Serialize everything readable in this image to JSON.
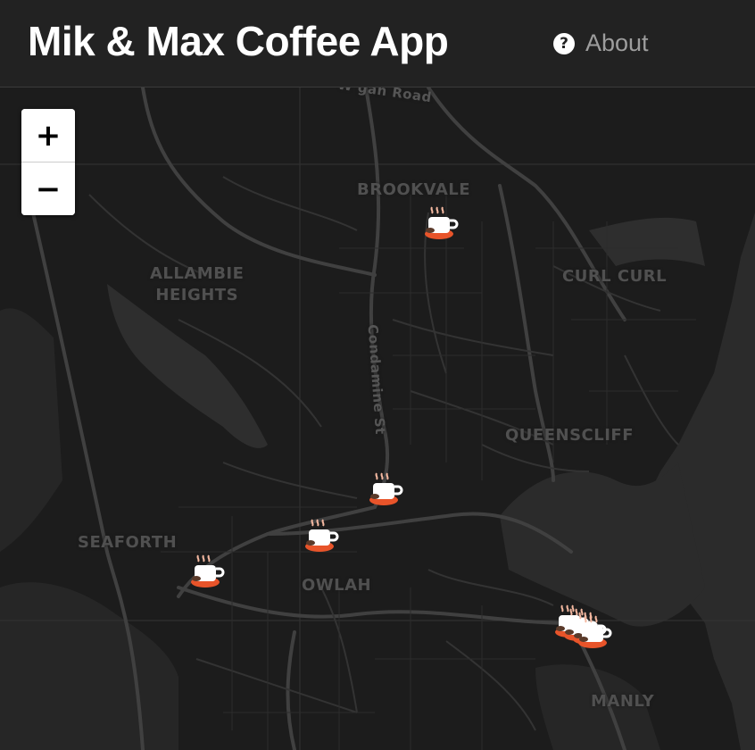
{
  "app": {
    "title": "Mik & Max Coffee App",
    "about_label": "About",
    "about_icon": "question-circle-icon"
  },
  "map": {
    "theme": "dark",
    "zoom_controls": {
      "zoom_in": "+",
      "zoom_out": "−"
    },
    "road_label": "Condamine St",
    "road_label_top": "W   gan Road",
    "place_labels": [
      {
        "id": "brookvale",
        "lines": [
          "BROOKVALE"
        ]
      },
      {
        "id": "allambie-heights",
        "lines": [
          "ALLAMBIE",
          "HEIGHTS"
        ]
      },
      {
        "id": "curl-curl",
        "lines": [
          "CURL CURL"
        ]
      },
      {
        "id": "queenscliff",
        "lines": [
          "QUEENSCLIFF"
        ]
      },
      {
        "id": "seaforth",
        "lines": [
          "SEAFORTH"
        ]
      },
      {
        "id": "balgowlah",
        "lines": [
          "OWLAH"
        ]
      },
      {
        "id": "manly",
        "lines": [
          "MANLY"
        ]
      }
    ],
    "marker_icon": "coffee-cup-icon",
    "marker_count": 8,
    "colors": {
      "land": "#1c1c1c",
      "water": "#2a2a2a",
      "roads": "#3c3c3c",
      "marker_cup": "#ffffff",
      "marker_saucer": "#e8542a",
      "marker_coffee": "#5a3a2a"
    }
  }
}
